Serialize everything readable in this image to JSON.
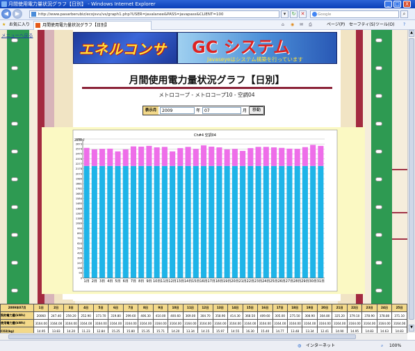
{
  "window": {
    "title": "月間使用電力量状況グラフ【日別】 - Windows Internet Explorer",
    "minimize": "_",
    "maximize": "□",
    "close": "X"
  },
  "browser": {
    "url": "http://www.pasarberubiz/ecojsvu/vs/graph1.php?USER=javalanee&PASS=javapass&CLIENT=100",
    "search_placeholder": "Google",
    "favorites": "お気に入り",
    "tab_title": "月間使用電力量状況グラフ【日別】",
    "tools": [
      "ページ(P)",
      "セーフティ(S)",
      "ツール(O)"
    ]
  },
  "page": {
    "back_link": "メニューへ戻る",
    "banner_left": "エネルコンサ",
    "banner_right_title": "GC システム",
    "banner_right_sub": "Javaseyeはシステム構築を行っています",
    "heading": "月間使用電力量状況グラフ【日別】",
    "breadcrumb": "メトロコープ - メトロコープ10 - 空調04",
    "form": {
      "label": "表示月",
      "year_value": "2009",
      "year_unit": "年",
      "month_value": "07",
      "month_unit": "月",
      "submit": "移動"
    }
  },
  "chart_data": {
    "type": "bar",
    "title": "Ch#4 空調04",
    "period": "2009-7",
    "categories": [
      "1日",
      "2日",
      "3日",
      "4日",
      "5日",
      "6日",
      "7日",
      "8日",
      "9日",
      "10日",
      "11日",
      "12日",
      "13日",
      "14日",
      "15日",
      "16日",
      "17日",
      "18日",
      "19日",
      "20日",
      "21日",
      "22日",
      "23日",
      "24日",
      "25日",
      "26日",
      "27日",
      "28日",
      "29日",
      "30日",
      "31日"
    ],
    "yticks": [
      "0",
      "99",
      "198",
      "297",
      "396",
      "495",
      "594",
      "693",
      "792",
      "891",
      "990",
      "1089",
      "1188",
      "1287",
      "1386",
      "1485",
      "1584",
      "1683",
      "1782",
      "1881",
      "1980",
      "2079",
      "2178",
      "2277",
      "2376",
      "2475",
      "2574",
      "2673",
      "2772"
    ],
    "ylim": [
      0,
      2772
    ],
    "series": [
      {
        "color": "#1eb4e8",
        "values": [
          2235,
          2235,
          2235,
          2235,
          2235,
          2235,
          2235,
          2235,
          2235,
          2235,
          2235,
          2235,
          2235,
          2235,
          2235,
          2235,
          2235,
          2235,
          2235,
          2235,
          2235,
          2235,
          2235,
          2235,
          2235,
          2235,
          2235,
          2235,
          2235,
          2235,
          2235
        ]
      },
      {
        "color": "#ee6ee9",
        "values": [
          360,
          330,
          340,
          345,
          290,
          330,
          390,
          385,
          400,
          370,
          380,
          290,
          355,
          380,
          340,
          410,
          385,
          370,
          330,
          340,
          300,
          355,
          380,
          380,
          370,
          360,
          345,
          340,
          375,
          420,
          400
        ]
      }
    ]
  },
  "table": {
    "header": [
      "2009年07月",
      "1日",
      "2日",
      "3日",
      "4日",
      "5日",
      "6日",
      "7日",
      "8日",
      "9日",
      "10日",
      "11日",
      "12日",
      "13日",
      "14日",
      "15日",
      "16日",
      "17日",
      "18日",
      "19日",
      "20日",
      "21日",
      "22日",
      "23日",
      "24日",
      "25日"
    ],
    "rows": [
      {
        "label": "契約電力量(kWh)",
        "values": [
          "20060",
          "247.40",
          "259.20",
          "252.90",
          "373.70",
          "319.80",
          "299.60",
          "406.30",
          "410.00",
          "400.60",
          "369.00",
          "304.70",
          "358.90",
          "414.30",
          "368.50",
          "409.60",
          "305.00",
          "275.50",
          "308.90",
          "304.80",
          "325.20",
          "379.10",
          "378.90",
          "378.80",
          "371.10"
        ]
      },
      {
        "label": "使用電力量(kWh)",
        "values": [
          "3164.00",
          "3164.00",
          "3164.00",
          "3164.00",
          "3164.00",
          "3164.00",
          "3164.00",
          "3164.00",
          "3164.00",
          "3164.00",
          "3164.00",
          "3164.00",
          "3164.00",
          "3164.00",
          "3164.00",
          "3164.00",
          "3164.00",
          "3164.00",
          "3164.00",
          "3164.00",
          "3164.00",
          "3164.00",
          "3164.00",
          "3164.00",
          "3164.00"
        ]
      },
      {
        "label": "CO2(kg)",
        "values": [
          "14.95",
          "13.83",
          "14.20",
          "11.23",
          "12.84",
          "15.25",
          "15.80",
          "15.35",
          "15.71",
          "14.20",
          "13.34",
          "14.15",
          "15.97",
          "14.55",
          "16.30",
          "15.40",
          "14.77",
          "13.48",
          "13.34",
          "12.41",
          "14.90",
          "14.95",
          "14.83",
          "14.63",
          "14.83"
        ]
      }
    ]
  },
  "status": {
    "left": "",
    "zone": "インターネット",
    "zoom": "100%"
  }
}
